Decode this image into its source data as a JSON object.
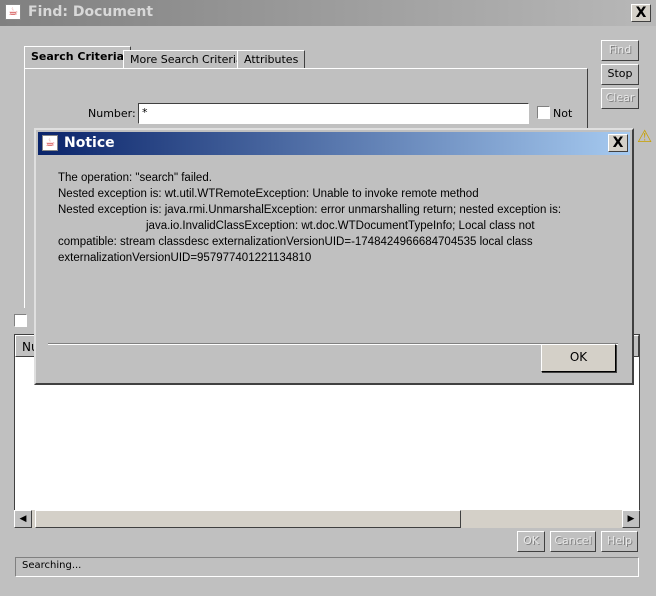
{
  "window": {
    "title": "Find: Document",
    "close": "X"
  },
  "tabs": [
    "Search Criteria",
    "More Search Criteria",
    "Attributes"
  ],
  "form": {
    "number_label": "Number:",
    "number_value": "*",
    "not_label": "Not"
  },
  "side_buttons": {
    "find": "Find",
    "stop": "Stop",
    "clear": "Clear"
  },
  "table": {
    "first_column": "Nu"
  },
  "bottom_buttons": {
    "ok": "OK",
    "cancel": "Cancel",
    "help": "Help"
  },
  "status": "Searching...",
  "dialog": {
    "title": "Notice",
    "close": "X",
    "lines": [
      "The operation:   \"search\" failed.",
      "Nested exception is: wt.util.WTRemoteException: Unable to invoke remote method",
      "Nested exception is: java.rmi.UnmarshalException: error unmarshalling return; nested exception is:",
      "java.io.InvalidClassException: wt.doc.WTDocumentTypeInfo; Local class not",
      "compatible: stream classdesc externalizationVersionUID=-1748424966684704535 local class",
      "externalizationVersionUID=957977401221134810"
    ],
    "ok": "OK"
  }
}
